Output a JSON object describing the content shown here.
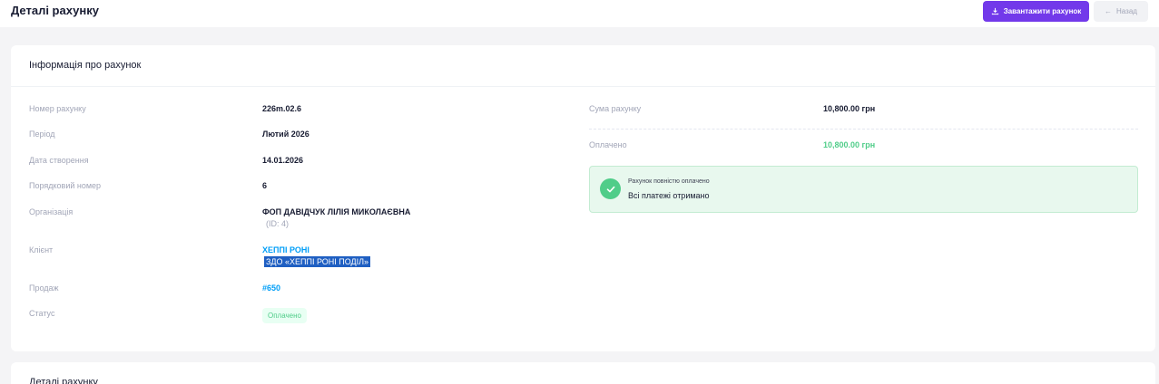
{
  "header": {
    "title": "Деталі рахунку",
    "download_label": "Завантажити рахунок",
    "back_label": "Назад"
  },
  "info_card": {
    "title": "Інформація про рахунок",
    "left": {
      "invoice_number_label": "Номер рахунку",
      "invoice_number": "226m.02.6",
      "period_label": "Період",
      "period": "Лютий 2026",
      "created_label": "Дата створення",
      "created": "14.01.2026",
      "sequence_label": "Порядковий номер",
      "sequence": "6",
      "organization_label": "Організація",
      "organization": "ФОП ДАВІДЧУК ЛІЛІЯ МИКОЛАЄВНА",
      "organization_id": "(ID: 4)",
      "client_label": "Клієнт",
      "client": "ХЕППІ РОНІ",
      "client_sub": "ЗДО «ХЕППІ РОНІ ПОДІЛ»",
      "sale_label": "Продаж",
      "sale": "#650",
      "status_label": "Статус",
      "status": "Оплачено"
    },
    "right": {
      "amount_label": "Сума рахунку",
      "amount": "10,800.00 грн",
      "paid_label": "Оплачено",
      "paid": "10,800.00 грн",
      "alert_title": "Рахунок повністю оплачено",
      "alert_text": "Всі платежі отримано"
    }
  },
  "details_card": {
    "title": "Деталі рахунку"
  },
  "colors": {
    "primary": "#7239ea",
    "link": "#009ef7",
    "success": "#50cd89",
    "highlight": "#1f5fc2"
  },
  "icons": {
    "download": "download-icon",
    "back": "arrow-left-icon",
    "check": "check-circle-icon"
  }
}
